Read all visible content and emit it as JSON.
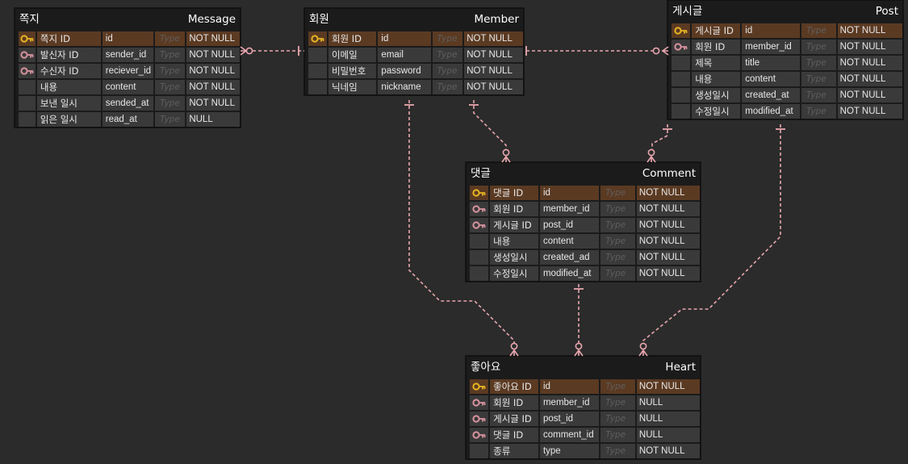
{
  "colors": {
    "connector": "#e9a6ae",
    "pk_key": "#e6b422",
    "fk_key": "#d8939f",
    "pk_row": "#5b3a22"
  },
  "entities": {
    "message": {
      "kr": "쪽지",
      "en": "Message",
      "rows": [
        {
          "label": "쪽지 ID",
          "name": "id",
          "type": "Type",
          "constraint": "NOT NULL",
          "key": "pk"
        },
        {
          "label": "발신자 ID",
          "name": "sender_id",
          "type": "Type",
          "constraint": "NOT NULL",
          "key": "fk"
        },
        {
          "label": "수신자 ID",
          "name": "reciever_id",
          "type": "Type",
          "constraint": "NOT NULL",
          "key": "fk"
        },
        {
          "label": "내용",
          "name": "content",
          "type": "Type",
          "constraint": "NOT NULL",
          "key": ""
        },
        {
          "label": "보낸 일시",
          "name": "sended_at",
          "type": "Type",
          "constraint": "NOT NULL",
          "key": ""
        },
        {
          "label": "읽은 일시",
          "name": "read_at",
          "type": "Type",
          "constraint": "NULL",
          "key": ""
        }
      ]
    },
    "member": {
      "kr": "회원",
      "en": "Member",
      "rows": [
        {
          "label": "회원 ID",
          "name": "id",
          "type": "Type",
          "constraint": "NOT NULL",
          "key": "pk"
        },
        {
          "label": "이메일",
          "name": "email",
          "type": "Type",
          "constraint": "NOT NULL",
          "key": ""
        },
        {
          "label": "비밀번호",
          "name": "password",
          "type": "Type",
          "constraint": "NOT NULL",
          "key": ""
        },
        {
          "label": "닉네임",
          "name": "nickname",
          "type": "Type",
          "constraint": "NOT NULL",
          "key": ""
        }
      ]
    },
    "post": {
      "kr": "게시글",
      "en": "Post",
      "rows": [
        {
          "label": "게시글 ID",
          "name": "id",
          "type": "Type",
          "constraint": "NOT NULL",
          "key": "pk"
        },
        {
          "label": "회원 ID",
          "name": "member_id",
          "type": "Type",
          "constraint": "NOT NULL",
          "key": "fk"
        },
        {
          "label": "제목",
          "name": "title",
          "type": "Type",
          "constraint": "NOT NULL",
          "key": ""
        },
        {
          "label": "내용",
          "name": "content",
          "type": "Type",
          "constraint": "NOT NULL",
          "key": ""
        },
        {
          "label": "생성일시",
          "name": "created_at",
          "type": "Type",
          "constraint": "NOT NULL",
          "key": ""
        },
        {
          "label": "수정일시",
          "name": "modified_at",
          "type": "Type",
          "constraint": "NOT NULL",
          "key": ""
        }
      ]
    },
    "comment": {
      "kr": "댓글",
      "en": "Comment",
      "rows": [
        {
          "label": "댓글 ID",
          "name": "id",
          "type": "Type",
          "constraint": "NOT NULL",
          "key": "pk"
        },
        {
          "label": "회원 ID",
          "name": "member_id",
          "type": "Type",
          "constraint": "NOT NULL",
          "key": "fk"
        },
        {
          "label": "게시글 ID",
          "name": "post_id",
          "type": "Type",
          "constraint": "NOT NULL",
          "key": "fk"
        },
        {
          "label": "내용",
          "name": "content",
          "type": "Type",
          "constraint": "NOT NULL",
          "key": ""
        },
        {
          "label": "생성일시",
          "name": "created_ad",
          "type": "Type",
          "constraint": "NOT NULL",
          "key": ""
        },
        {
          "label": "수정일시",
          "name": "modified_at",
          "type": "Type",
          "constraint": "NOT NULL",
          "key": ""
        }
      ]
    },
    "heart": {
      "kr": "좋아요",
      "en": "Heart",
      "rows": [
        {
          "label": "좋아요 ID",
          "name": "id",
          "type": "Type",
          "constraint": "NOT NULL",
          "key": "pk"
        },
        {
          "label": "회원 ID",
          "name": "member_id",
          "type": "Type",
          "constraint": "NULL",
          "key": "fk"
        },
        {
          "label": "게시글 ID",
          "name": "post_id",
          "type": "Type",
          "constraint": "NULL",
          "key": "fk"
        },
        {
          "label": "댓글 ID",
          "name": "comment_id",
          "type": "Type",
          "constraint": "NULL",
          "key": "fk"
        },
        {
          "label": "종류",
          "name": "type",
          "type": "Type",
          "constraint": "NOT NULL",
          "key": ""
        }
      ]
    }
  }
}
